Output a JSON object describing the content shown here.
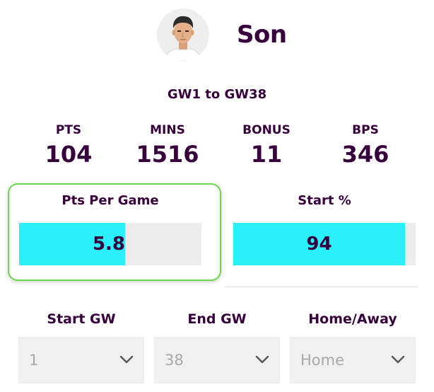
{
  "player": {
    "name": "Son",
    "avatar_icon": "player-avatar-icon"
  },
  "range_label": "GW1 to GW38",
  "stats": [
    {
      "label": "PTS",
      "value": "104"
    },
    {
      "label": "MINS",
      "value": "1516"
    },
    {
      "label": "BONUS",
      "value": "11"
    },
    {
      "label": "BPS",
      "value": "346"
    }
  ],
  "metrics": {
    "pts_per_game": {
      "title": "Pts Per Game",
      "value": "5.8",
      "fill_percent": 58
    },
    "start_percent": {
      "title": "Start %",
      "value": "94",
      "fill_percent": 94
    }
  },
  "filters": {
    "start_gw": {
      "label": "Start GW",
      "value": "1"
    },
    "end_gw": {
      "label": "End GW",
      "value": "38"
    },
    "home_away": {
      "label": "Home/Away",
      "value": "Home"
    }
  },
  "colors": {
    "text": "#37003c",
    "bar_fill": "#2bf0fb",
    "bar_track": "#ececec",
    "highlight_border": "#6cd94a"
  }
}
